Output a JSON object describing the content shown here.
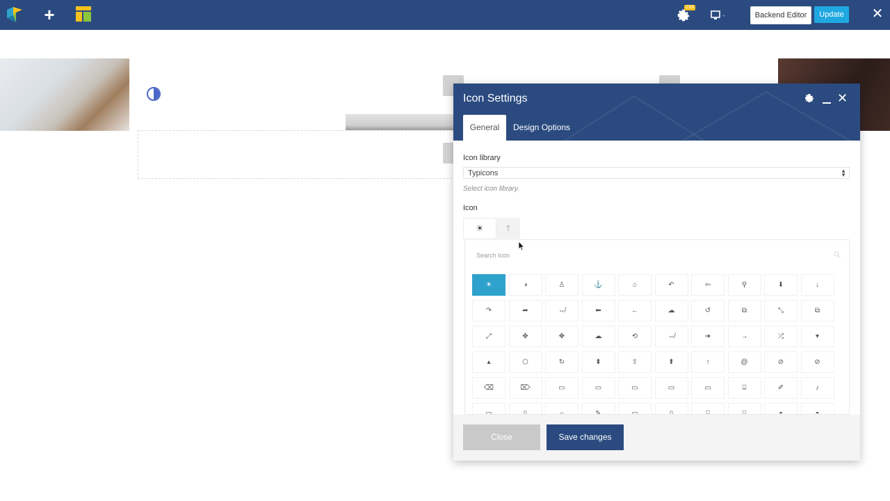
{
  "navbar": {
    "logo_icon": "visual-composer-logo-icon",
    "add_icon": "plus-icon",
    "add_glyph": "+",
    "layout_icon": "layout-icon",
    "settings_icon": "gear-icon",
    "settings_badge": "CSS",
    "device_icon": "monitor-icon",
    "backend_editor_label": "Backend Editor",
    "update_label": "Update",
    "close_glyph": "✕",
    "color": "#2b4b80",
    "accent": "#1fa7e0"
  },
  "modal": {
    "title": "Icon Settings",
    "header_icons": [
      "gear-icon",
      "minimize-icon",
      "close-icon"
    ],
    "close_glyph": "✕",
    "tabs": [
      {
        "label": "General",
        "active": true
      },
      {
        "label": "Design Options",
        "active": false
      }
    ],
    "fields": {
      "library_label": "Icon library",
      "library_value": "Typicons",
      "library_help": "Select icon library.",
      "icon_label": "Icon",
      "icon_selected_glyph": "☀",
      "icon_toggle_glyph": "🡑"
    },
    "picker": {
      "search_placeholder": "Search Icon",
      "active_color": "#2ea2cc",
      "rows": [
        [
          "☀",
          "◑",
          "♙",
          "⚓",
          "⌂",
          "↶",
          "⇦",
          "⚲",
          "⬇",
          "↓"
        ],
        [
          "↷",
          "➦",
          "⇎",
          "⬅",
          "←",
          "☁",
          "↺",
          "⧉",
          "⤡",
          "⧉"
        ],
        [
          "⤢",
          "✥",
          "✥",
          "☁",
          "⟲",
          "⇎",
          "➜",
          "→",
          "⤮",
          "▾"
        ],
        [
          "▴",
          "⬡",
          "↻",
          "⬍",
          "⇧",
          "⬆",
          "↑",
          "@",
          "⊘",
          "⊘"
        ],
        [
          "⌫",
          "⌦",
          "▭",
          "▭",
          "▭",
          "▭",
          "▭",
          "⌸",
          "✐",
          "♪"
        ],
        [
          "▭",
          "▯",
          "⌓",
          "✎",
          "▭",
          "▯",
          "⌸",
          "⌸",
          "◓",
          "◓"
        ]
      ]
    },
    "footer": {
      "close_label": "Close",
      "save_label": "Save changes"
    }
  }
}
